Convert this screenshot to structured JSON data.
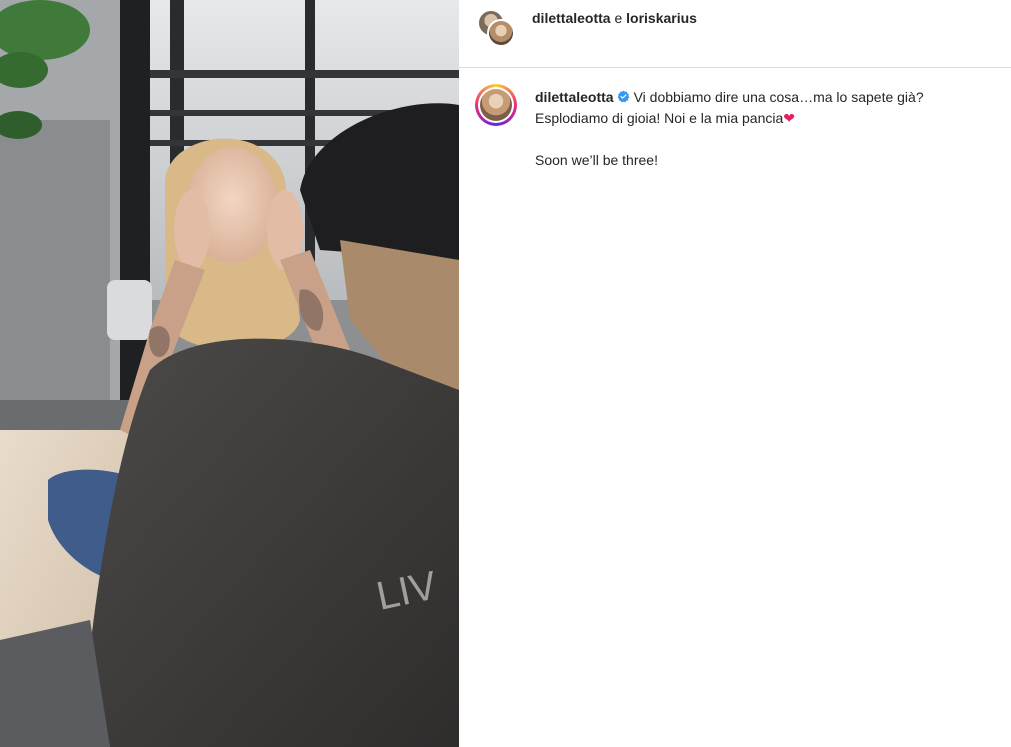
{
  "post": {
    "header": {
      "user1": "dilettaleotta",
      "conjunction": "e",
      "user2": "loriskarius"
    },
    "caption": {
      "username": "dilettaleotta",
      "line1": "Vi dobbiamo dire una cosa…ma lo sapete già?",
      "line2": "Esplodiamo di gioia! Noi e la mia pancia",
      "heart": "❤",
      "line3": "Soon we’ll be three!"
    }
  },
  "icons": {
    "verified": "verified-badge-icon",
    "heart": "red-heart-icon"
  },
  "colors": {
    "verified_blue": "#3897f0",
    "heart_red": "#e0245e",
    "text": "#262626"
  }
}
